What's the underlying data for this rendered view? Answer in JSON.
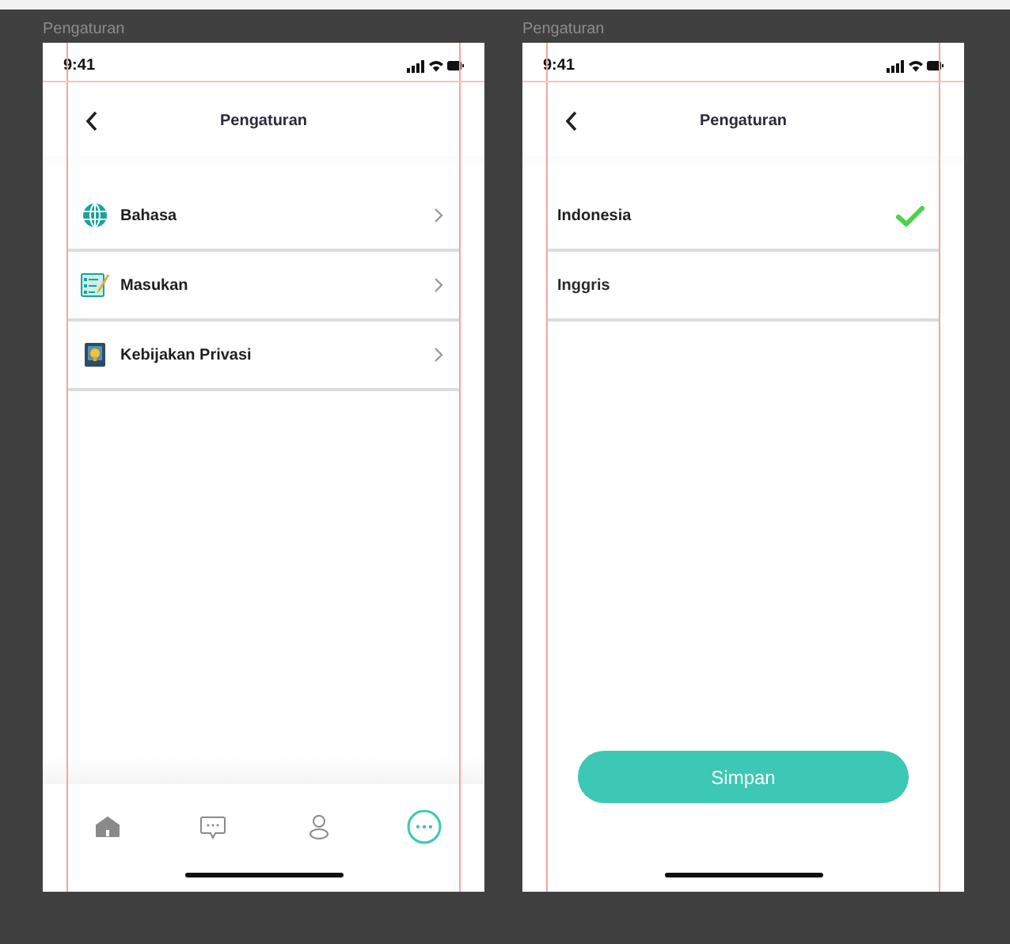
{
  "frames": [
    {
      "kind": "menu",
      "label": "Pengaturan",
      "time": "9:41",
      "title": "Pengaturan",
      "items": [
        {
          "kind": "globe",
          "label": "Bahasa"
        },
        {
          "kind": "form",
          "label": "Masukan"
        },
        {
          "kind": "badge",
          "label": "Kebijakan Privasi"
        }
      ],
      "nav": [
        {
          "kind": "home",
          "selected": false
        },
        {
          "kind": "chat",
          "selected": false
        },
        {
          "kind": "person",
          "selected": false
        },
        {
          "kind": "more",
          "selected": true
        }
      ]
    },
    {
      "kind": "language",
      "label": "Pengaturan",
      "time": "9:41",
      "title": "Pengaturan",
      "options": [
        {
          "label": "Indonesia",
          "selected": true
        },
        {
          "label": "Inggris",
          "selected": false
        }
      ],
      "button": "Simpan"
    }
  ]
}
